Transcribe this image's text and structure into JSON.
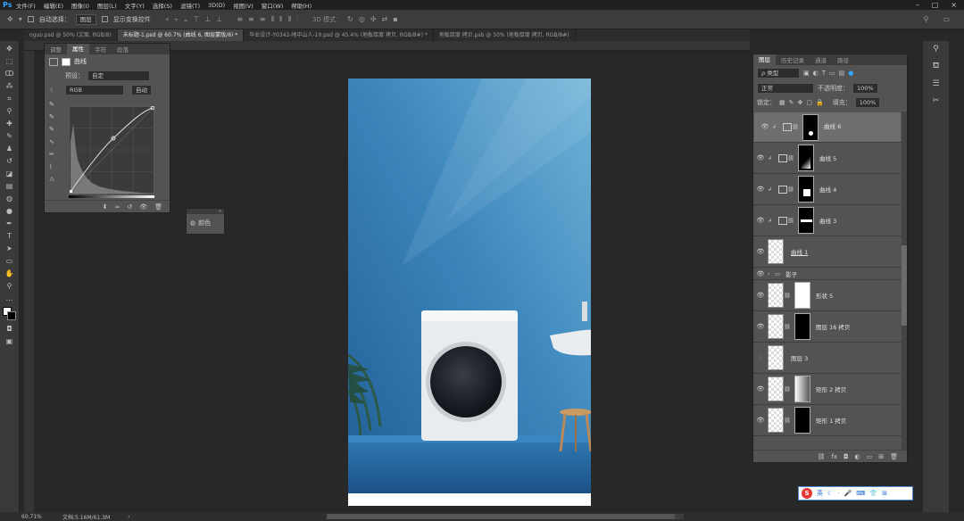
{
  "app": {
    "logo": "Ps"
  },
  "menu": [
    "文件(F)",
    "编辑(E)",
    "图像(I)",
    "图层(L)",
    "文字(Y)",
    "选择(S)",
    "滤镜(T)",
    "3D(D)",
    "视图(V)",
    "窗口(W)",
    "帮助(H)"
  ],
  "options_bar": {
    "auto_select_label": "自动选择：",
    "auto_select_value": "图层",
    "show_transform_label": "显示变换控件",
    "mode_3d": "3D 模式："
  },
  "tabs": [
    {
      "label": "oguo.psd @ 50% (文案, RGB/8)",
      "active": false
    },
    {
      "label": "未标题-1.psd @ 60.7% (曲线 6, 图层蒙版/8) *",
      "active": true
    },
    {
      "label": "毕业设计-Y0342-地中山人-10.psd @ 45.4% (地板厚度 拷贝, RGB/8#) *",
      "active": false
    },
    {
      "label": "地板厚度 拷贝.psb @ 50% (地板厚度 拷贝, RGB/8#)",
      "active": false
    }
  ],
  "properties_panel": {
    "tabs": [
      "调整",
      "属性",
      "字符",
      "段落"
    ],
    "active_tab": "属性",
    "title": "曲线",
    "preset_label": "预设：",
    "preset_value": "自定",
    "channel_value": "RGB",
    "auto_button": "自动"
  },
  "color_panel": {
    "label": "颜色"
  },
  "layers_panel": {
    "tabs": [
      "图层",
      "历史记录",
      "通道",
      "路径"
    ],
    "active_tab": "图层",
    "filter_value": "ρ 类型",
    "blend_mode": "正常",
    "opacity_label": "不透明度：",
    "opacity_value": "100%",
    "lock_label": "锁定：",
    "fill_label": "填充：",
    "fill_value": "100%",
    "layers": [
      {
        "name": "曲线 6",
        "selected": true
      },
      {
        "name": "曲线 5",
        "selected": false
      },
      {
        "name": "曲线 4",
        "selected": false
      },
      {
        "name": "曲线 3",
        "selected": false
      },
      {
        "name": "曲线 1",
        "selected": false
      },
      {
        "name": "影子",
        "selected": false
      },
      {
        "name": "形状 5",
        "selected": false
      },
      {
        "name": "图层 16 拷贝",
        "selected": false
      },
      {
        "name": "图层 3",
        "selected": false
      },
      {
        "name": "矩形 2 拷贝",
        "selected": false
      },
      {
        "name": "矩形 1 拷贝",
        "selected": false
      }
    ]
  },
  "status_bar": {
    "zoom": "60.71%",
    "doc_info": "文档:5.16M/61.3M"
  },
  "ime": {
    "label": "英"
  },
  "colors": {
    "canvas_bg": "#282828",
    "panel": "#535353",
    "accent": "#31a8ff"
  }
}
